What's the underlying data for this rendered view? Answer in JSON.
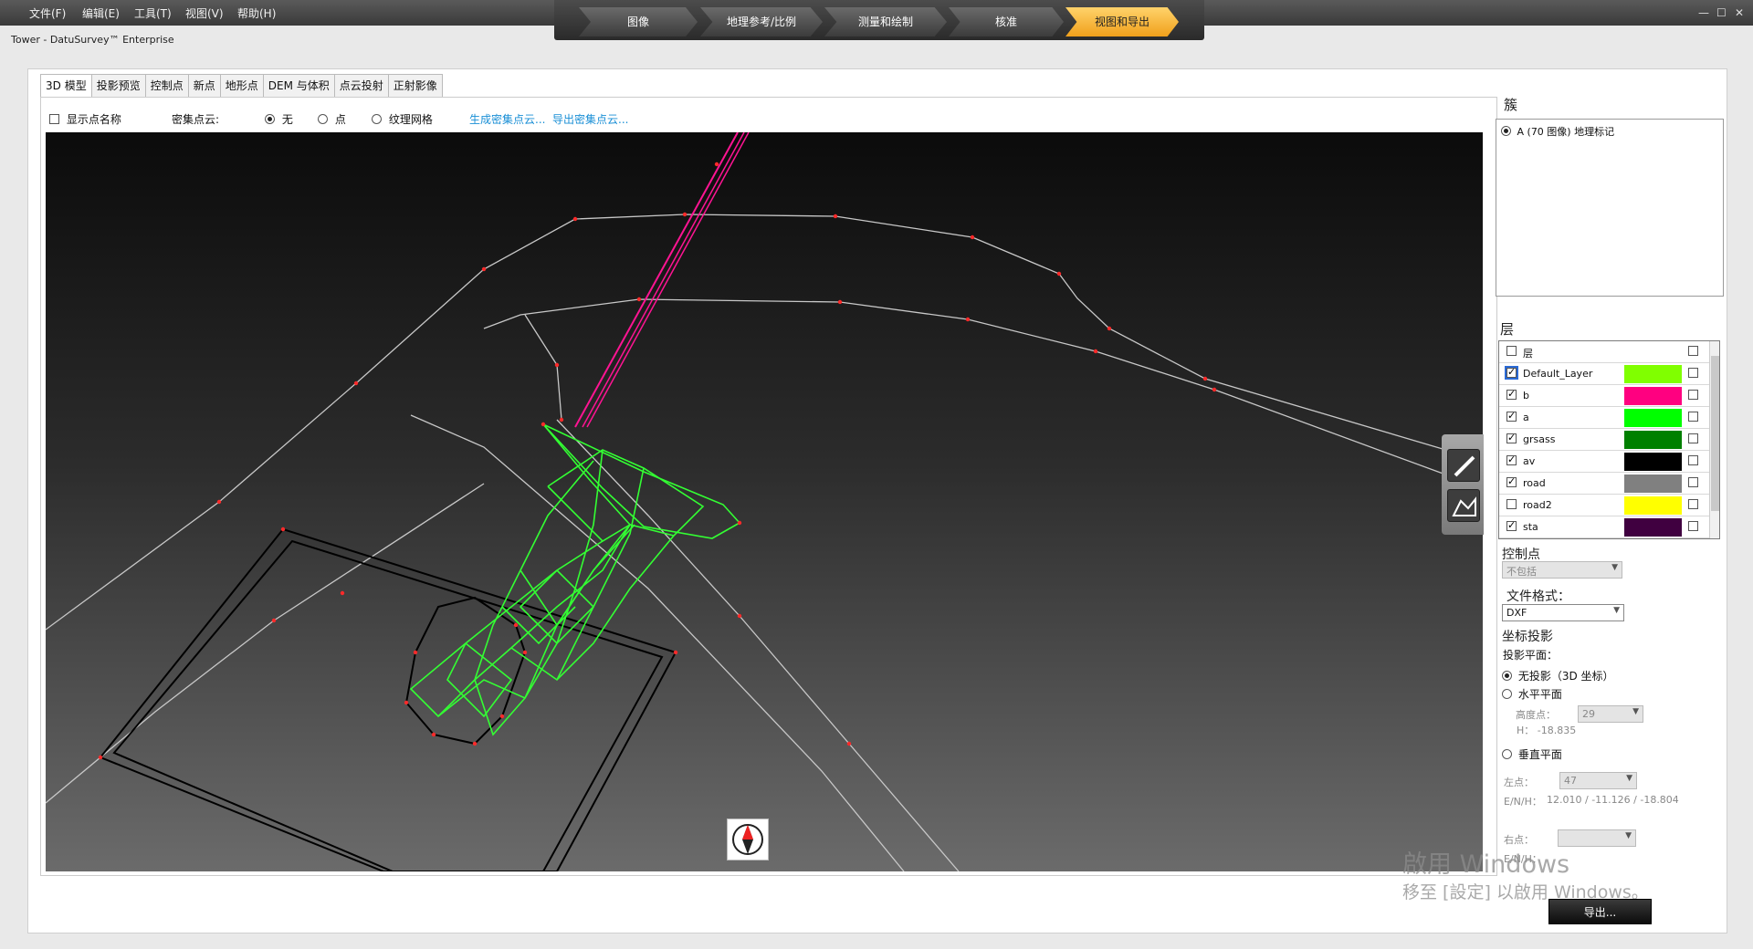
{
  "window": {
    "subtitle": "Tower - DatuSurvey™ Enterprise",
    "menu": [
      "文件(F)",
      "编辑(E)",
      "工具(T)",
      "视图(V)",
      "帮助(H)"
    ],
    "controls": [
      "—",
      "☐",
      "✕"
    ]
  },
  "workflow": {
    "steps": [
      "图像",
      "地理参考/比例",
      "测量和绘制",
      "核准",
      "视图和导出"
    ],
    "active_index": 4
  },
  "tabs": {
    "items": [
      "3D 模型",
      "投影预览",
      "控制点",
      "新点",
      "地形点",
      "DEM 与体积",
      "点云投射",
      "正射影像"
    ],
    "active_index": 0
  },
  "options": {
    "show_point_names": "显示点名称",
    "dense_cloud_label": "密集点云:",
    "radio_none": "无",
    "radio_points": "点",
    "radio_mesh": "纹理网格",
    "link_generate": "生成密集点云...",
    "link_export": "导出密集点云..."
  },
  "right_panel": {
    "cluster_title": "簇",
    "cluster_item": "A (70 图像) 地理标记",
    "layer_title": "层",
    "layer_header": "层",
    "layers": [
      {
        "name": "Default_Layer",
        "color": "#80ff00",
        "checked": true
      },
      {
        "name": "b",
        "color": "#ff0080",
        "checked": true
      },
      {
        "name": "a",
        "color": "#00ff00",
        "checked": true
      },
      {
        "name": "grsass",
        "color": "#008000",
        "checked": true
      },
      {
        "name": "av",
        "color": "#000000",
        "checked": true
      },
      {
        "name": "road",
        "color": "#808080",
        "checked": true
      },
      {
        "name": "road2",
        "color": "#ffff00",
        "checked": false
      },
      {
        "name": "sta",
        "color": "#400040",
        "checked": true
      }
    ],
    "control_points_title": "控制点",
    "control_points_value": "不包括",
    "file_format_label": "文件格式：",
    "file_format_value": "DXF",
    "coord_proj_title": "坐标投影",
    "proj_plane_label": "投影平面：",
    "radio_no_proj": "无投影（3D 坐标）",
    "radio_horizontal": "水平平面",
    "height_point_label": "高度点：",
    "height_point_value": "29",
    "height_h": "H： -18.835",
    "radio_vertical": "垂直平面",
    "left_point_label": "左点：",
    "left_point_value": "47",
    "enh_label": "E/N/H：",
    "enh_value": "12.010 / -11.126 / -18.804",
    "right_point_label": "右点：",
    "enh2": "E/N/H：",
    "export_button": "导出..."
  },
  "watermark": {
    "line1": "啟用 Windows",
    "line2": "移至 [設定] 以啟用 Windows。"
  }
}
